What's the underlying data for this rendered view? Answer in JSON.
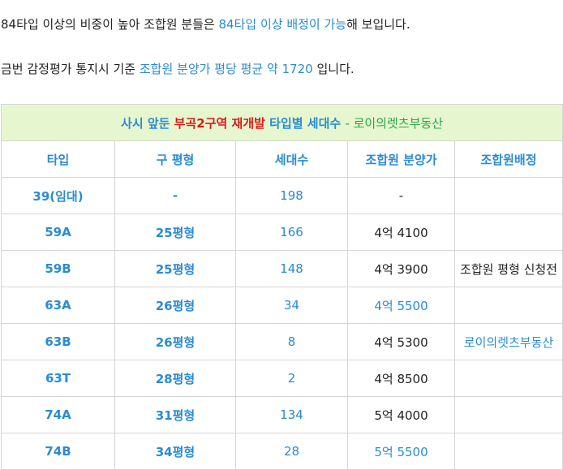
{
  "intro": {
    "line1": [
      {
        "text": "84타입 이상의 비중이 높아 조합원  분들은 ",
        "highlight": false
      },
      {
        "text": "84타입 이상 배정이 가능",
        "highlight": true
      },
      {
        "text": "해 보입니다.",
        "highlight": false
      }
    ],
    "line2": [
      {
        "text": "금번 감정평가 통지시 기준 ",
        "highlight": false
      },
      {
        "text": "조합원 분양가 평당 평균 약 1720",
        "highlight": true
      },
      {
        "text": " 입니다.",
        "highlight": false
      }
    ]
  },
  "table": {
    "title": {
      "prefix": "사시 앞둔 ",
      "project": "부곡2구역 재개발",
      "suffix": " 타입별 세대수 ",
      "credit": "- 로이의렛츠부동산"
    },
    "headers": [
      "타입",
      "구 평형",
      "세대수",
      "조합원 분양가",
      "조합원배정"
    ],
    "rows": [
      {
        "type": "39(임대)",
        "old": "-",
        "count": "198",
        "price": "-",
        "price_blue": false,
        "note": "",
        "note_blue": false
      },
      {
        "type": "59A",
        "old": "25평형",
        "count": "166",
        "price": "4억 4100",
        "price_blue": false,
        "note": "",
        "note_blue": false
      },
      {
        "type": "59B",
        "old": "25평형",
        "count": "148",
        "price": "4억 3900",
        "price_blue": false,
        "note": "조합원 평형 신청전",
        "note_blue": false
      },
      {
        "type": "63A",
        "old": "26평형",
        "count": "34",
        "price": "4억 5500",
        "price_blue": true,
        "note": "",
        "note_blue": false
      },
      {
        "type": "63B",
        "old": "26평형",
        "count": "8",
        "price": "4억 5300",
        "price_blue": false,
        "note": "로이의렛츠부동산",
        "note_blue": true
      },
      {
        "type": "63T",
        "old": "28평형",
        "count": "2",
        "price": "4억 8500",
        "price_blue": false,
        "note": "",
        "note_blue": false
      },
      {
        "type": "74A",
        "old": "31평형",
        "count": "134",
        "price": "5억 4000",
        "price_blue": false,
        "note": "",
        "note_blue": false
      },
      {
        "type": "74B",
        "old": "34평형",
        "count": "28",
        "price": "5억 5500",
        "price_blue": true,
        "note": "",
        "note_blue": false
      }
    ]
  },
  "colors": {
    "accent": "#2a8bd6",
    "highlight_red": "#e01818",
    "credit_green": "#2aa64a",
    "title_bg": "#e6f7cf"
  }
}
